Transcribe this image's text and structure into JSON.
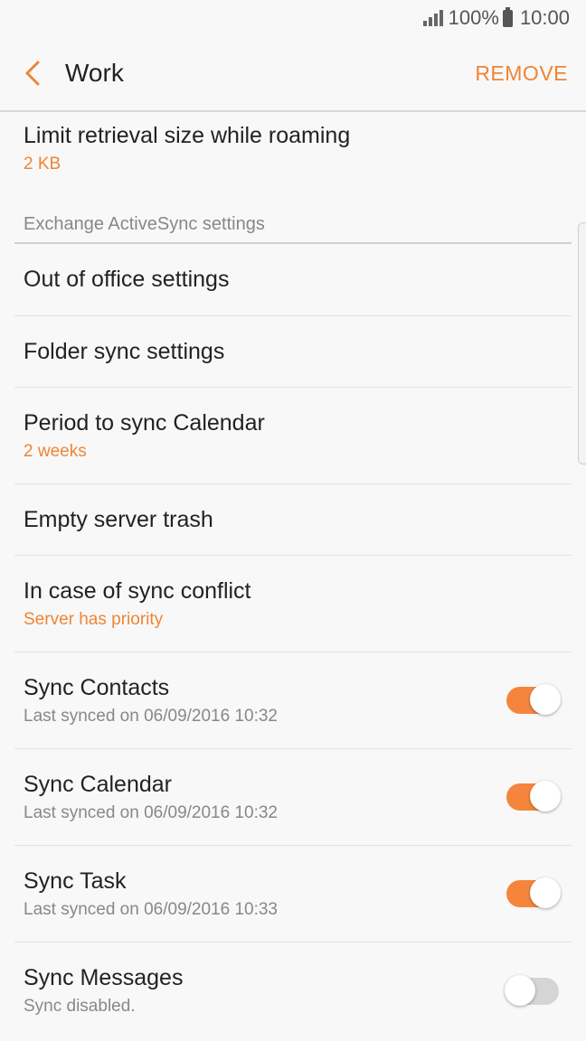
{
  "status": {
    "battery": "100%",
    "time": "10:00"
  },
  "appbar": {
    "title": "Work",
    "remove_label": "REMOVE"
  },
  "roaming": {
    "label": "Limit retrieval size while roaming",
    "value": "2 KB"
  },
  "section": {
    "header": "Exchange ActiveSync settings"
  },
  "items": [
    {
      "label": "Out of office settings"
    },
    {
      "label": "Folder sync settings"
    },
    {
      "label": "Period to sync Calendar",
      "value": "2 weeks"
    },
    {
      "label": "Empty server trash"
    },
    {
      "label": "In case of sync conflict",
      "value": "Server has priority"
    }
  ],
  "toggles": [
    {
      "label": "Sync Contacts",
      "sub": "Last synced on 06/09/2016  10:32",
      "on": true
    },
    {
      "label": "Sync Calendar",
      "sub": "Last synced on 06/09/2016  10:32",
      "on": true
    },
    {
      "label": "Sync Task",
      "sub": "Last synced on 06/09/2016  10:33",
      "on": true
    },
    {
      "label": "Sync Messages",
      "sub": "Sync disabled.",
      "on": false
    }
  ],
  "colors": {
    "accent": "#f08434",
    "toggle_on": "#f5853d",
    "toggle_off": "#d5d5d5"
  },
  "icons": {
    "back": "chevron-left-icon",
    "signal": "signal-icon",
    "battery": "battery-icon"
  }
}
